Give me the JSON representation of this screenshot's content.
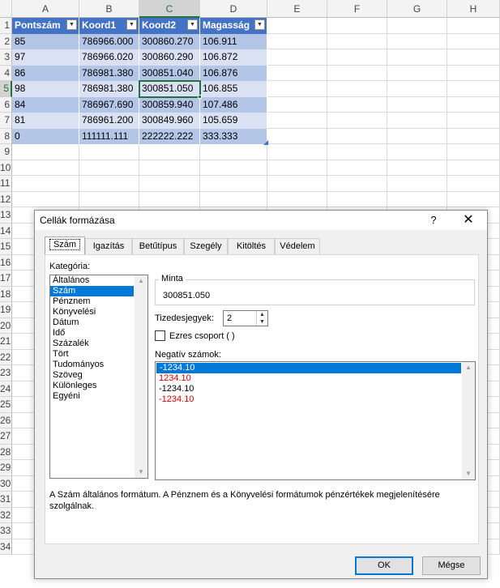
{
  "sheet": {
    "columns": [
      "A",
      "B",
      "C",
      "D",
      "E",
      "F",
      "G",
      "H"
    ],
    "rows": [
      "1",
      "2",
      "3",
      "4",
      "5",
      "6",
      "7",
      "8",
      "9",
      "10",
      "11",
      "12",
      "13",
      "14",
      "15",
      "16",
      "17",
      "18",
      "19",
      "20",
      "21",
      "22",
      "23",
      "24",
      "25",
      "26",
      "27",
      "28",
      "29",
      "30",
      "31",
      "32",
      "33",
      "34"
    ],
    "active_column": "C",
    "active_row": "5",
    "table_headers": [
      "Pontszám",
      "Koord1",
      "Koord2",
      "Magasság"
    ],
    "table_rows": [
      [
        "85",
        "786966.000",
        "300860.270",
        "106.911"
      ],
      [
        "97",
        "786966.020",
        "300860.290",
        "106.872"
      ],
      [
        "86",
        "786981.380",
        "300851.040",
        "106.876"
      ],
      [
        "98",
        "786981.380",
        "300851.050",
        "106.855"
      ],
      [
        "84",
        "786967.690",
        "300859.940",
        "107.486"
      ],
      [
        "81",
        "786961.200",
        "300849.960",
        "105.659"
      ],
      [
        "0",
        "111111.111",
        "222222.222",
        "333.333"
      ]
    ],
    "colors": {
      "header": "#4472c4",
      "band_dark": "#b4c6e7",
      "band_light": "#d9e1f2",
      "selection": "#21723e"
    },
    "filter_icon": "dropdown-arrow-icon"
  },
  "dialog": {
    "title": "Cellák formázása",
    "help": "?",
    "close": "✕",
    "tabs": [
      "Szám",
      "Igazítás",
      "Betűtípus",
      "Szegély",
      "Kitöltés",
      "Védelem"
    ],
    "selected_tab": "Szám",
    "category_label": "Kategória:",
    "categories": [
      "Általános",
      "Szám",
      "Pénznem",
      "Könyvelési",
      "Dátum",
      "Idő",
      "Százalék",
      "Tört",
      "Tudományos",
      "Szöveg",
      "Különleges",
      "Egyéni"
    ],
    "selected_category": "Szám",
    "sample_label": "Minta",
    "sample_value": "300851.050",
    "decimals_label": "Tizedesjegyek:",
    "decimals_value": "2",
    "thousands_label": "Ezres csoport ( )",
    "negative_label": "Negatív számok:",
    "negative_options": [
      {
        "text": "-1234.10",
        "color": "#ffffff",
        "selected": true
      },
      {
        "text": "1234.10",
        "color": "#d00000",
        "selected": false
      },
      {
        "text": "-1234.10",
        "color": "#000000",
        "selected": false
      },
      {
        "text": "-1234.10",
        "color": "#d00000",
        "selected": false
      }
    ],
    "description": "A Szám általános formátum. A Pénznem és a Könyvelési formátumok pénzértékek megjelenítésére szolgálnak.",
    "ok_label": "OK",
    "cancel_label": "Mégse"
  }
}
